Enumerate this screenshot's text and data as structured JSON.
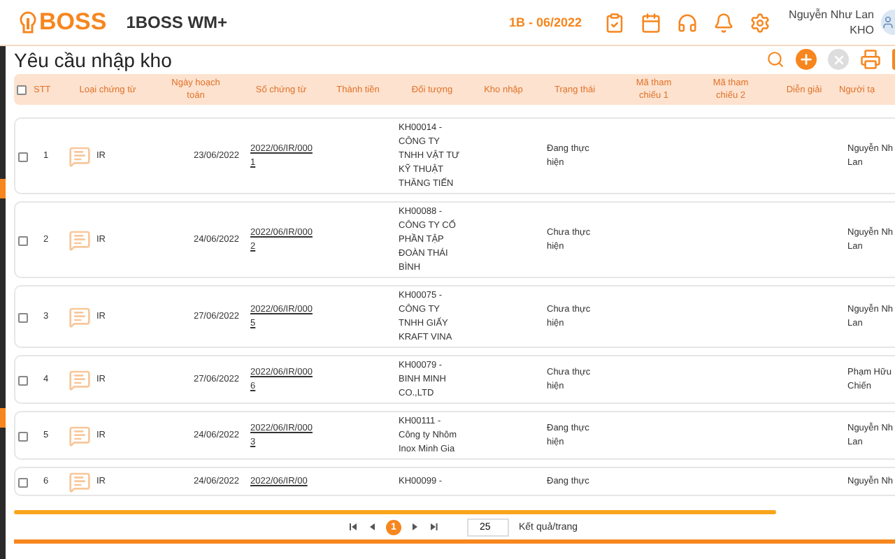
{
  "header": {
    "logo": "BOSS",
    "app_name": "1BOSS WM+",
    "period": "1B - 06/2022",
    "user_name": "Nguyễn Như Lan",
    "user_role": "KHO"
  },
  "page": {
    "title": "Yêu cầu nhập kho",
    "toolbar": [
      {
        "kind": "search",
        "disabled": false
      },
      {
        "kind": "add",
        "disabled": false
      },
      {
        "kind": "delete",
        "disabled": true
      },
      {
        "kind": "print",
        "disabled": false
      }
    ]
  },
  "table": {
    "select_all": {
      "checked": false
    },
    "columns": [
      "STT",
      "Loại chứng từ",
      "Ngày hoạch toán",
      "Số chứng từ",
      "Thành tiền",
      "Đối tượng",
      "Kho nhập",
      "Trạng thái",
      "Mã tham chiếu 1",
      "Mã tham chiếu 2",
      "Diễn giải",
      "Người tạ"
    ],
    "rows": [
      {
        "checked": false,
        "stt": "1",
        "type": "IR",
        "date": "23/06/2022",
        "doc": "2022/06/IR/0001",
        "entity": "KH00014 - CÔNG TY TNHH VẬT TƯ KỸ THUẬT THĂNG TIẾN",
        "status": "Đang thực hiện",
        "creator": [
          "Nguyễn Nh",
          "Lan"
        ]
      },
      {
        "checked": false,
        "stt": "2",
        "type": "IR",
        "date": "24/06/2022",
        "doc": "2022/06/IR/0002",
        "entity": "KH00088 - CÔNG TY CỔ PHẦN TẬP ĐOÀN THÁI BÌNH",
        "status": "Chưa thực hiện",
        "creator": [
          "Nguyễn Nh",
          "Lan"
        ]
      },
      {
        "checked": false,
        "stt": "3",
        "type": "IR",
        "date": "27/06/2022",
        "doc": "2022/06/IR/0005",
        "entity": "KH00075 - CÔNG TY TNHH GIẤY KRAFT VINA",
        "status": "Chưa thực hiện",
        "creator": [
          "Nguyễn Nh",
          "Lan"
        ]
      },
      {
        "checked": false,
        "stt": "4",
        "type": "IR",
        "date": "27/06/2022",
        "doc": "2022/06/IR/0006",
        "entity": "KH00079 - BINH MINH CO.,LTD",
        "status": "Chưa thực hiện",
        "creator": [
          "Phạm Hữu",
          "Chiến"
        ]
      },
      {
        "checked": false,
        "stt": "5",
        "type": "IR",
        "date": "24/06/2022",
        "doc": "2022/06/IR/0003",
        "entity": "KH00111 - Công ty Nhôm Inox Minh Gia",
        "status": "Đang thực hiện",
        "creator": [
          "Nguyễn Nh",
          "Lan"
        ]
      },
      {
        "checked": false,
        "stt": "6",
        "type": "IR",
        "date": "24/06/2022",
        "doc": "2022/06/IR/00",
        "entity": "KH00099 -",
        "status": "Đang thực",
        "creator": [
          "Nguyễn Nh"
        ]
      }
    ]
  },
  "pagination": {
    "pages": [
      {
        "label": "1",
        "selected": true
      }
    ],
    "per_page": "25",
    "per_page_label": "Kết quả/trang"
  }
}
